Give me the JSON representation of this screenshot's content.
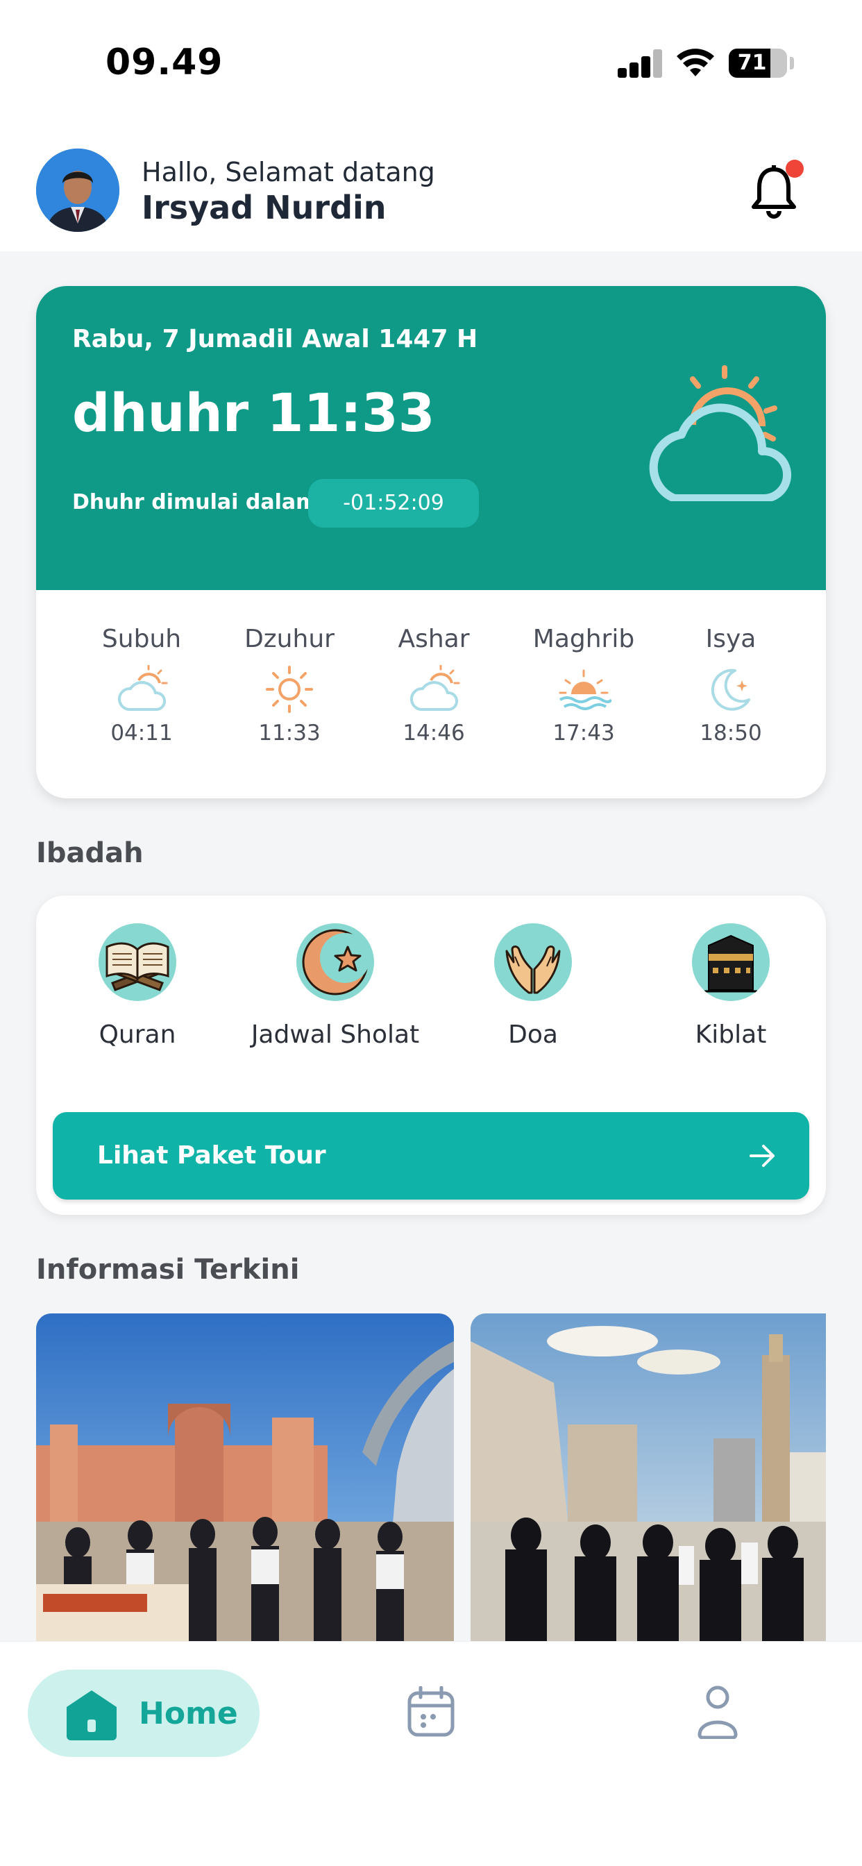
{
  "status_bar": {
    "time": "09.49",
    "battery": "71",
    "battery_level": 0.71
  },
  "header": {
    "greeting": "Hallo, Selamat datang",
    "user_name": "Irsyad Nurdin"
  },
  "prayer_card": {
    "hijri_date": "Rabu, 7 Jumadil Awal 1447 H",
    "current_prayer": "dhuhr 11:33",
    "starts_label": "Dhuhr dimulai dalam",
    "countdown": "-01:52:09",
    "times": [
      {
        "name": "Subuh",
        "time": "04:11",
        "icon": "cloud-sun-icon"
      },
      {
        "name": "Dzuhur",
        "time": "11:33",
        "icon": "sun-icon"
      },
      {
        "name": "Ashar",
        "time": "14:46",
        "icon": "cloud-sun-icon"
      },
      {
        "name": "Maghrib",
        "time": "17:43",
        "icon": "sunset-icon"
      },
      {
        "name": "Isya",
        "time": "18:50",
        "icon": "moon-stars-icon"
      }
    ]
  },
  "ibadah": {
    "title": "Ibadah",
    "items": [
      {
        "label": "Quran",
        "icon": "quran-icon"
      },
      {
        "label": "Jadwal Sholat",
        "icon": "crescent-star-icon"
      },
      {
        "label": "Doa",
        "icon": "praying-hands-icon"
      },
      {
        "label": "Kiblat",
        "icon": "kaaba-icon"
      }
    ],
    "tour_button": "Lihat Paket Tour"
  },
  "news": {
    "title": "Informasi Terkini"
  },
  "nav": {
    "home_label": "Home"
  },
  "colors": {
    "primary": "#0f9a88",
    "accent": "#10b3a8",
    "notification": "#ef4438"
  }
}
